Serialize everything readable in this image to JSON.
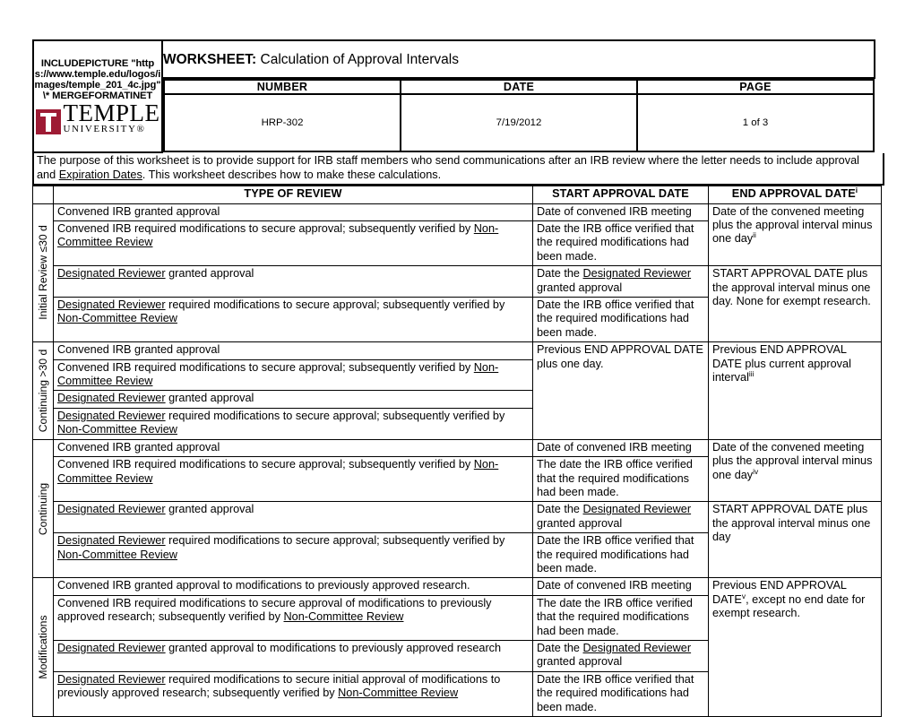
{
  "header": {
    "logo_field_code": "INCLUDEPICTURE \"https://www.temple.edu/logos/images/temple_201_4c.jpg\" \\* MERGEFORMATINET",
    "logo_name": "TEMPLE",
    "logo_sub": "UNIVERSITY®",
    "worksheet_label": "WORKSHEET:",
    "worksheet_title": "Calculation of Approval Intervals",
    "cols": {
      "number_label": "NUMBER",
      "date_label": "DATE",
      "page_label": "PAGE"
    },
    "values": {
      "number": "HRP-302",
      "date": "7/19/2012",
      "page": "1 of 3"
    }
  },
  "purpose": {
    "text_1": "The purpose of this worksheet is to provide support for IRB staff members who send communications after an IRB review where the letter needs to include approval and ",
    "link": "Expiration Dates",
    "text_2": ". This worksheet describes how to make these calculations."
  },
  "table": {
    "columns": {
      "type_of_review": "TYPE OF REVIEW",
      "start_approval_date": "START APPROVAL DATE",
      "end_approval_date": "END APPROVAL DATE",
      "end_approval_date_note": "i"
    },
    "sections": [
      {
        "label": "Initial Review ≤30 d",
        "rows": [
          {
            "type_plain": "Convened IRB granted approval"
          },
          {
            "type_plain": "Convened IRB required modifications to secure approval; subsequently verified by ",
            "type_link": "Non-Committee Review"
          },
          {
            "type_link_lead": "Designated Reviewer",
            "type_plain": " granted approval"
          },
          {
            "type_link_lead": "Designated Reviewer",
            "type_plain": " required modifications to secure approval; subsequently verified by ",
            "type_link": "Non-Committee Review"
          }
        ],
        "start_cells": [
          {
            "text": "Date of convened IRB meeting",
            "rows": 1
          },
          {
            "text": "Date the IRB office verified that the required modifications had been made.",
            "rows": 1
          },
          {
            "text_prefix": "Date the ",
            "link": "Designated Reviewer",
            "text_suffix": " granted approval",
            "rows": 1
          },
          {
            "text": "Date the IRB office verified that the required modifications had been made.",
            "rows": 1
          }
        ],
        "end_cells": [
          {
            "text": "Date of the convened meeting plus the approval interval minus one day",
            "note": "ii",
            "rows": 2
          },
          {
            "text": "START APPROVAL DATE plus the approval interval minus one day. None for exempt research.",
            "note": "",
            "rows": 2
          }
        ]
      },
      {
        "label": "Continuing >30 d",
        "rows": [
          {
            "type_plain": "Convened IRB granted approval"
          },
          {
            "type_plain": "Convened IRB required modifications to secure approval; subsequently verified by ",
            "type_link": "Non-Committee Review"
          },
          {
            "type_link_lead": "Designated Reviewer",
            "type_plain": " granted approval"
          },
          {
            "type_link_lead": "Designated Reviewer",
            "type_plain": " required modifications to secure approval; subsequently verified by ",
            "type_link": "Non-Committee Review"
          }
        ],
        "start_cells": [
          {
            "text": "Previous END APPROVAL DATE plus one day.",
            "rows": 4
          }
        ],
        "end_cells": [
          {
            "text": "Previous END APPROVAL DATE plus current approval interval",
            "note": "iii",
            "rows": 4
          }
        ]
      },
      {
        "label": "Continuing",
        "rows": [
          {
            "type_plain": "Convened IRB granted approval"
          },
          {
            "type_plain": "Convened IRB required modifications to secure approval; subsequently verified by ",
            "type_link": "Non-Committee Review"
          },
          {
            "type_link_lead": "Designated Reviewer",
            "type_plain": " granted approval"
          },
          {
            "type_link_lead": "Designated Reviewer",
            "type_plain": " required modifications to secure approval; subsequently verified by ",
            "type_link": "Non-Committee Review"
          }
        ],
        "start_cells": [
          {
            "text": "Date of convened IRB meeting",
            "rows": 1
          },
          {
            "text": "The date the IRB office verified that the required modifications had been made.",
            "rows": 1
          },
          {
            "text_prefix": "Date the ",
            "link": "Designated Reviewer",
            "text_suffix": " granted approval",
            "rows": 1
          },
          {
            "text": "Date the IRB office verified that the required modifications had been made.",
            "rows": 1
          }
        ],
        "end_cells": [
          {
            "text": "Date of the convened meeting plus the approval interval minus one day",
            "note": "iv",
            "rows": 2
          },
          {
            "text": "START APPROVAL DATE plus the approval interval minus one day",
            "note": "",
            "rows": 2
          }
        ]
      },
      {
        "label": "Modifications",
        "rows": [
          {
            "type_plain": "Convened IRB granted approval to modifications to previously approved research."
          },
          {
            "type_plain": "Convened IRB required modifications to secure approval of modifications to previously approved research; subsequently verified by ",
            "type_link": "Non-Committee Review"
          },
          {
            "type_link_lead": "Designated Reviewer",
            "type_plain": " granted approval to modifications to previously approved research"
          },
          {
            "type_link_lead": "Designated Reviewer",
            "type_plain": " required modifications to secure initial approval of modifications to previously approved research; subsequently verified by ",
            "type_link": "Non-Committee Review"
          }
        ],
        "start_cells": [
          {
            "text": "Date of convened IRB meeting",
            "rows": 1
          },
          {
            "text": "The date the IRB office verified that the required modifications had been made.",
            "rows": 1
          },
          {
            "text_prefix": "Date the ",
            "link": "Designated Reviewer",
            "text_suffix": " granted approval",
            "rows": 1
          },
          {
            "text": "Date the IRB office verified that the required modifications had been made.",
            "rows": 1
          }
        ],
        "end_cells": [
          {
            "text_prefix": "Previous END APPROVAL DATE",
            "note": "v",
            "text_suffix": ", except no end date for exempt research.",
            "rows": 4
          }
        ]
      }
    ]
  }
}
